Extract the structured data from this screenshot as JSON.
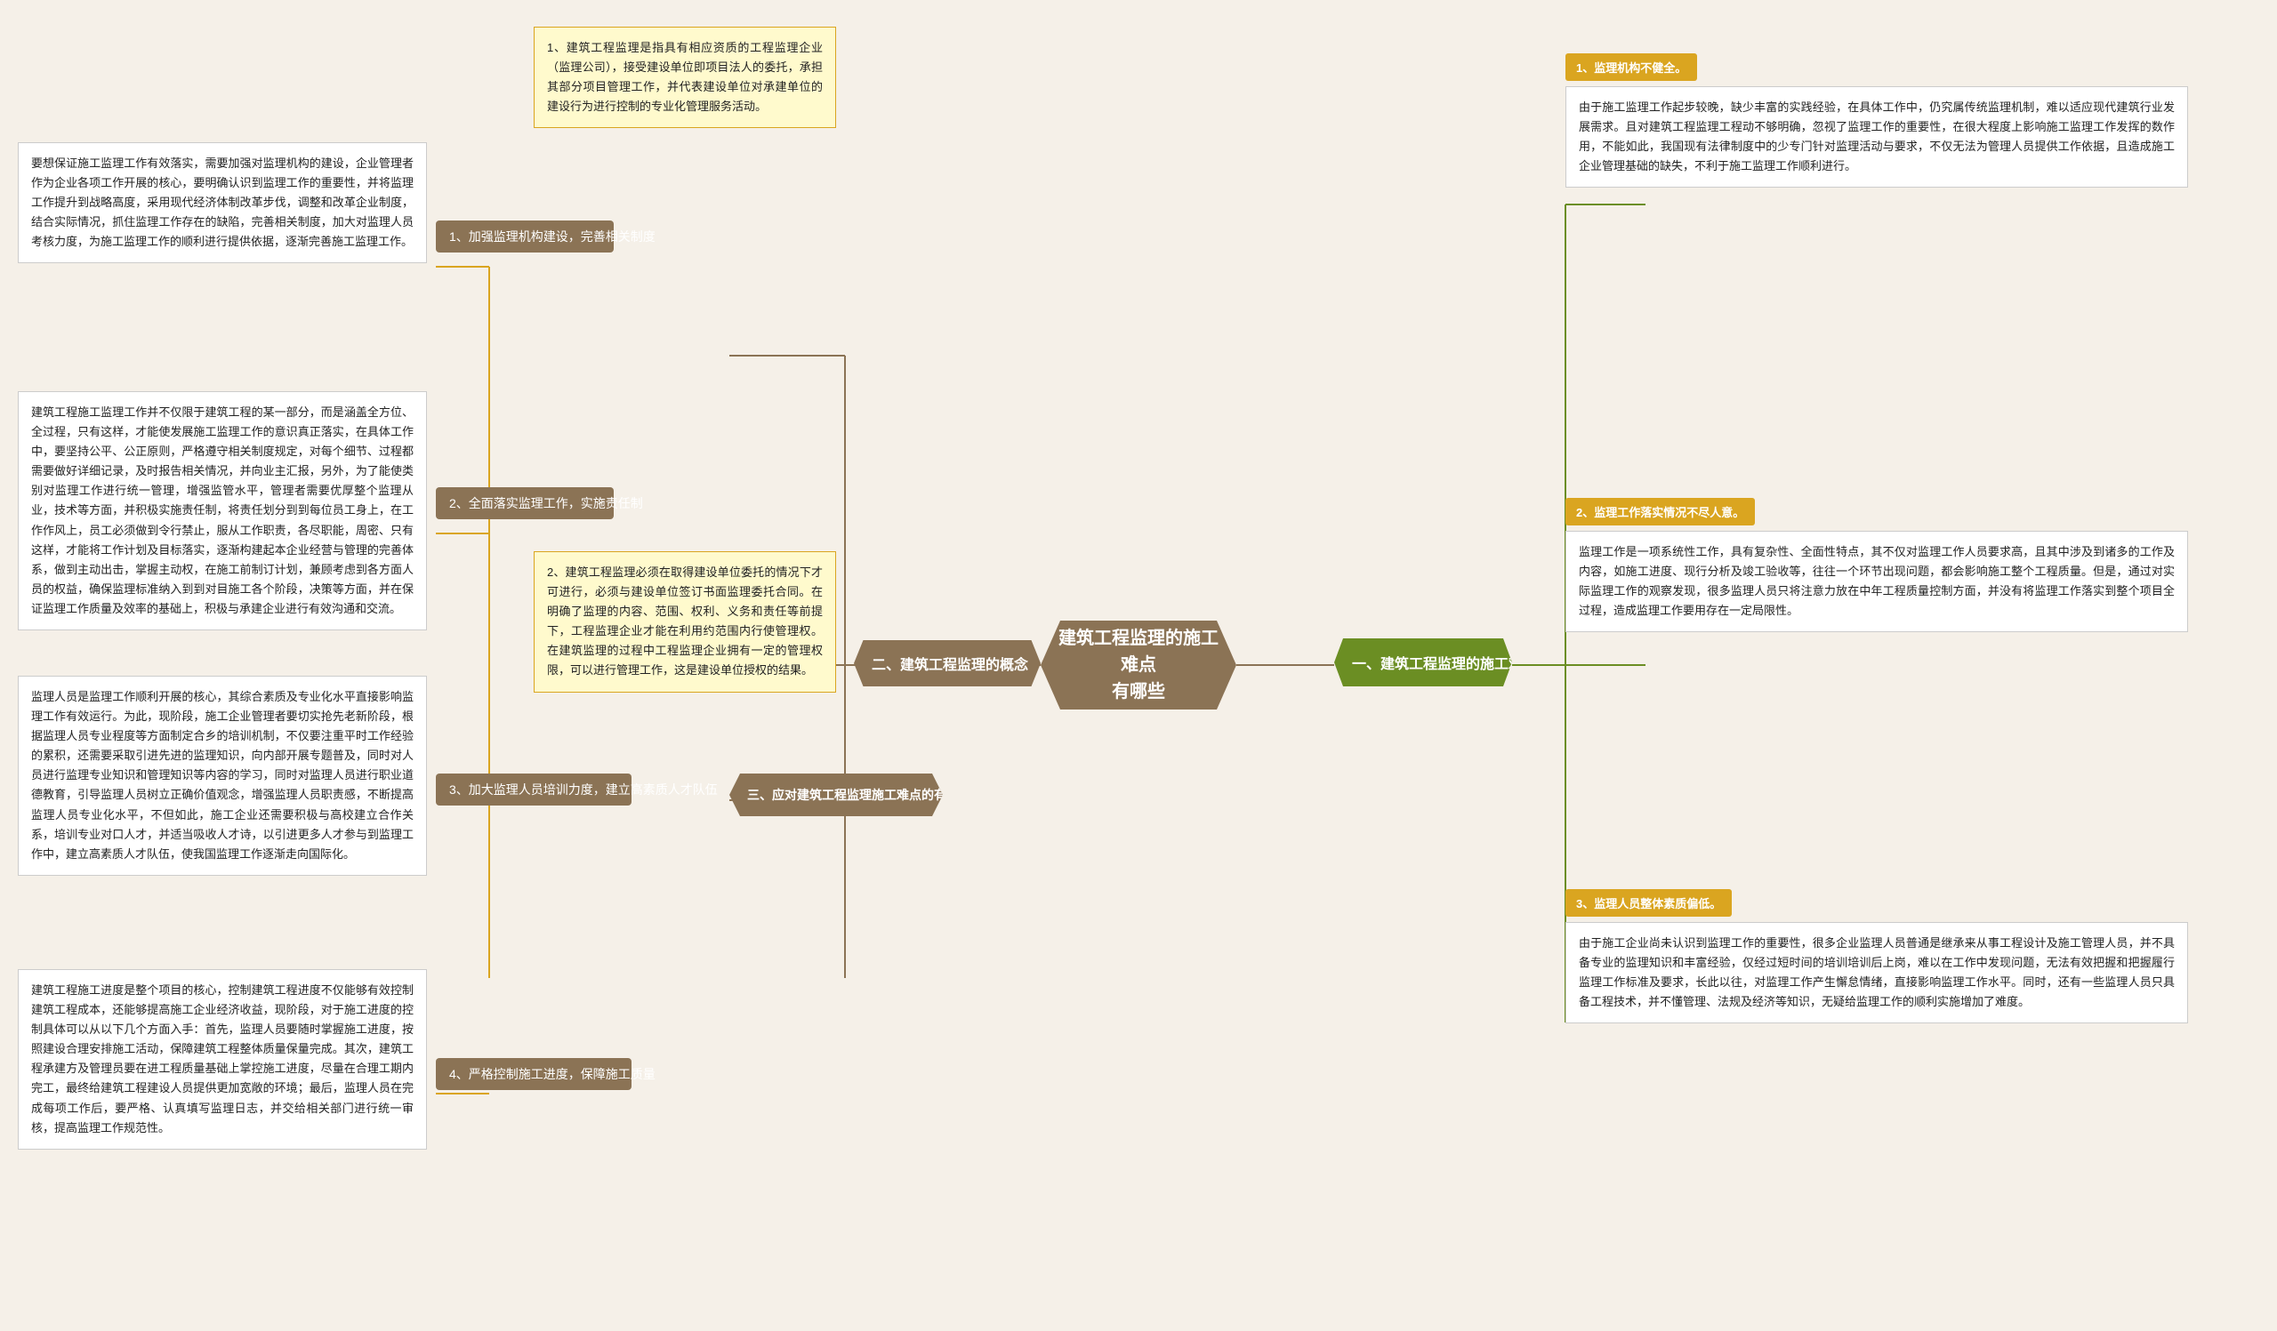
{
  "central": {
    "title": "建筑工程监理的施工难点\n有哪些"
  },
  "left_branch": {
    "main_label": "二、建筑工程监理的概念",
    "sub1": {
      "label": "1、建筑工程监理是指具有相应资质的工程监理企业（监理公司），接受建设单位即项目法人的委托，承担其部分项目管理工作，并代表建设单位对承建单位的建设行为进行控制的专业化管理服务活动。"
    },
    "sub2": {
      "label": "2、建筑工程监理必须在取得建设单位委托的情况下才可进行，必须与建设单位签订书面监理委托合同。在明确了监理的内容、范围、权利、义务和责任等前提下，工程监理企业才能在利用约范围内行使管理权。在建筑监理的过程中工程监理企业拥有一定的管理权限，可以进行管理工作，这是建设单位授权的结果。"
    },
    "measures": {
      "label": "三、应对建筑工程监理施工难点的有效措施",
      "items": [
        {
          "num": "1、加强监理机构建设，完善相关制度",
          "text": "要想保证施工监理工作有效落实，需要加强对监理机构的建设，企业管理者作为企业各项工作开展的核心，要明确认识到监理工作的重要性，并将监理工作提升到战略高度，采用现代经济体制改革步伐，调整和改革企业制度，结合实际情况，抓住监理工作存在的缺陷，完善相关制度，加大对监理人员考核力度，为施工监理工作的顺利进行提供依据，逐渐完善施工监理工作。"
        },
        {
          "num": "2、全面落实监理工作，实施责任制",
          "text": "建筑工程施工监理工作并不仅限于建筑工程的某一部分，而是涵盖全方位、全过程，只有这样，才能使发展施工监理工作的意识真正落实，在具体工作中，要坚持公平、公正原则，严格遵守相关制度规定，对每个细节、过程都需要做好详细记录，及时报告相关情况，并向业主汇报，另外，为了能使类别对监理工作进行统一管理，增强监管水平，管理者需要优厚整个监理从业，技术等方面，并积极实施责任制，将责任划分到到每位员工身上，在工作作风上，员工必须做到令行禁止，服从工作职责，各尽职能，周密、只有这样，才能将工作计划及目标落实，逐渐构建起本企业经营与管理的完善体系，做到主动出击，掌握主动权，在施工前制订计划，兼顾考虑到各方面人员的权益，确保监理标准纳入到到对目施工各个阶段，决策等方面，并在保证监理工作质量及效率的基础上，积极与承建企业进行有效沟通和交流。"
        },
        {
          "num": "3、加大监理人员培训力度，建立高素质人才队伍",
          "text": "监理人员是监理工作顺利开展的核心，其综合素质及专业化水平直接影响监理工作有效运行。为此，现阶段，施工企业管理者要切实抢先老新阶段，根据监理人员专业程度等方面制定合乡的培训机制，不仅要注重平时工作经验的累积，还需要采取引进先进的监理知识，向内部开展专题普及，同时对人员进行监理专业知识和管理知识等内容的学习，同时对监理人员进行职业道德教育，引导监理人员树立正确价值观念，增强监理人员职责感，不断提高监理人员专业化水平，不但如此，施工企业还需要积极与高校建立合作关系，培训专业对口人才，并适当吸收人才诗，以引进更多人才参与到监理工作中，建立高素质人才队伍，使我国监理工作逐渐走向国际化。"
        },
        {
          "num": "4、严格控制施工进度，保障施工质量",
          "text": "建筑工程施工进度是整个项目的核心，控制建筑工程进度不仅能够有效控制建筑工程成本，还能够提高施工企业经济收益，现阶段，对于施工进度的控制具体可以从以下几个方面入手：首先，监理人员要随时掌握施工进度，按照建设合理安排施工活动，保障建筑工程整体质量保量完成。其次，建筑工程承建方及管理员要在进工程质量基础上掌控施工进度，尽量在合理工期内完工，最终给建筑工程建设人员提供更加宽敞的环境；最后，监理人员在完成每项工作后，要严格、认真填写监理日志，并交给相关部门进行统一审核，提高监理工作规范性。"
        }
      ]
    }
  },
  "right_branch": {
    "main_label": "一、建筑工程监理的施工难点",
    "items": [
      {
        "num": "1、监理机构不健全。",
        "text": "由于施工监理工作起步较晚，缺少丰富的实践经验，在具体工作中，仍究属传统监理机制，难以适应现代建筑行业发展需求。且对建筑工程监理工程动不够明确，忽视了监理工作的重要性，在很大程度上影响施工监理工作发挥的数作用，不能如此，我国现有法律制度中的少专门针对监理活动与要求，不仅无法为管理人员提供工作依据，且造成施工企业管理基础的缺失，不利于施工监理工作顺利进行。"
      },
      {
        "num": "2、监理工作落实情况不尽人意。",
        "text": "监理工作是一项系统性工作，具有复杂性、全面性特点，其不仅对监理工作人员要求高，且其中涉及到诸多的工作及内容，如施工进度、现行分析及竣工验收等，往往一个环节出现问题，都会影响施工整个工程质量。但是，通过对实际监理工作的观察发现，很多监理人员只将注意力放在中年工程质量控制方面，并没有将监理工作落实到整个项目全过程，造成监理工作要用存在一定局限性。"
      },
      {
        "num": "3、监理人员整体素质偏低。",
        "text": "由于施工企业尚未认识到监理工作的重要性，很多企业监理人员普通是继承来从事工程设计及施工管理人员，并不具备专业的监理知识和丰富经验，仅经过短时间的培训培训后上岗，难以在工作中发现问题，无法有效把握和把握履行监理工作标准及要求，长此以往，对监理工作产生懈怠情绪，直接影响监理工作水平。同时，还有一些监理人员只具备工程技术，并不懂管理、法规及经济等知识，无疑给监理工作的顺利实施增加了难度。"
      }
    ]
  },
  "colors": {
    "brown": "#8B7355",
    "gold": "#DAA520",
    "green": "#6B8E23",
    "bg": "#f5f0e8",
    "white": "#ffffff"
  }
}
